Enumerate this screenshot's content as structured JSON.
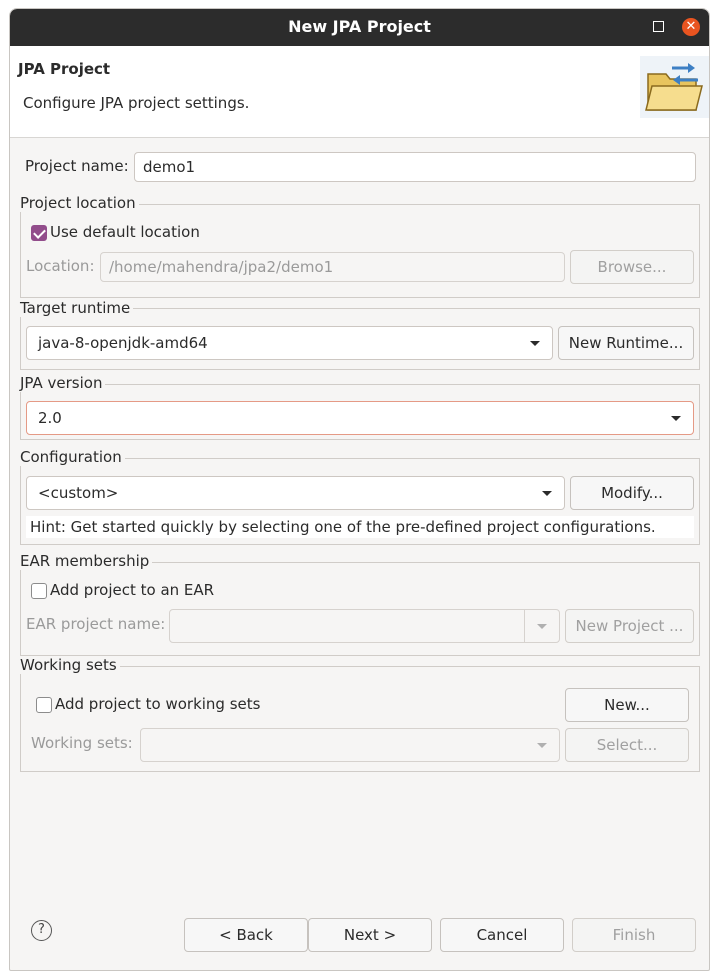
{
  "window": {
    "title": "New JPA Project"
  },
  "banner": {
    "heading": "JPA Project",
    "description": "Configure JPA project settings.",
    "icon": "folder-arrows-icon"
  },
  "project_name": {
    "label": "Project name:",
    "value": "demo1"
  },
  "project_location": {
    "legend": "Project location",
    "use_default_label": "Use default location",
    "use_default_checked": true,
    "location_label": "Location:",
    "location_value": "/home/mahendra/jpa2/demo1",
    "browse_label": "Browse..."
  },
  "target_runtime": {
    "legend": "Target runtime",
    "selected": "java-8-openjdk-amd64",
    "new_runtime_label": "New Runtime..."
  },
  "jpa_version": {
    "legend": "JPA version",
    "selected": "2.0"
  },
  "configuration": {
    "legend": "Configuration",
    "selected": "<custom>",
    "modify_label": "Modify...",
    "hint": "Hint: Get started quickly by selecting one of the pre-defined project configurations."
  },
  "ear_membership": {
    "legend": "EAR membership",
    "add_label": "Add project to an EAR",
    "add_checked": false,
    "ear_name_label": "EAR project name:",
    "new_project_label": "New Project ..."
  },
  "working_sets": {
    "legend": "Working sets",
    "add_label": "Add project to working sets",
    "add_checked": false,
    "new_label": "New...",
    "sets_label": "Working sets:",
    "select_label": "Select..."
  },
  "footer": {
    "help": "?",
    "back": "< Back",
    "next": "Next >",
    "cancel": "Cancel",
    "finish": "Finish"
  },
  "colors": {
    "titlebar": "#2c2c2c",
    "close": "#e95420",
    "checkbox": "#924d8b",
    "focus": "#e59a86"
  }
}
